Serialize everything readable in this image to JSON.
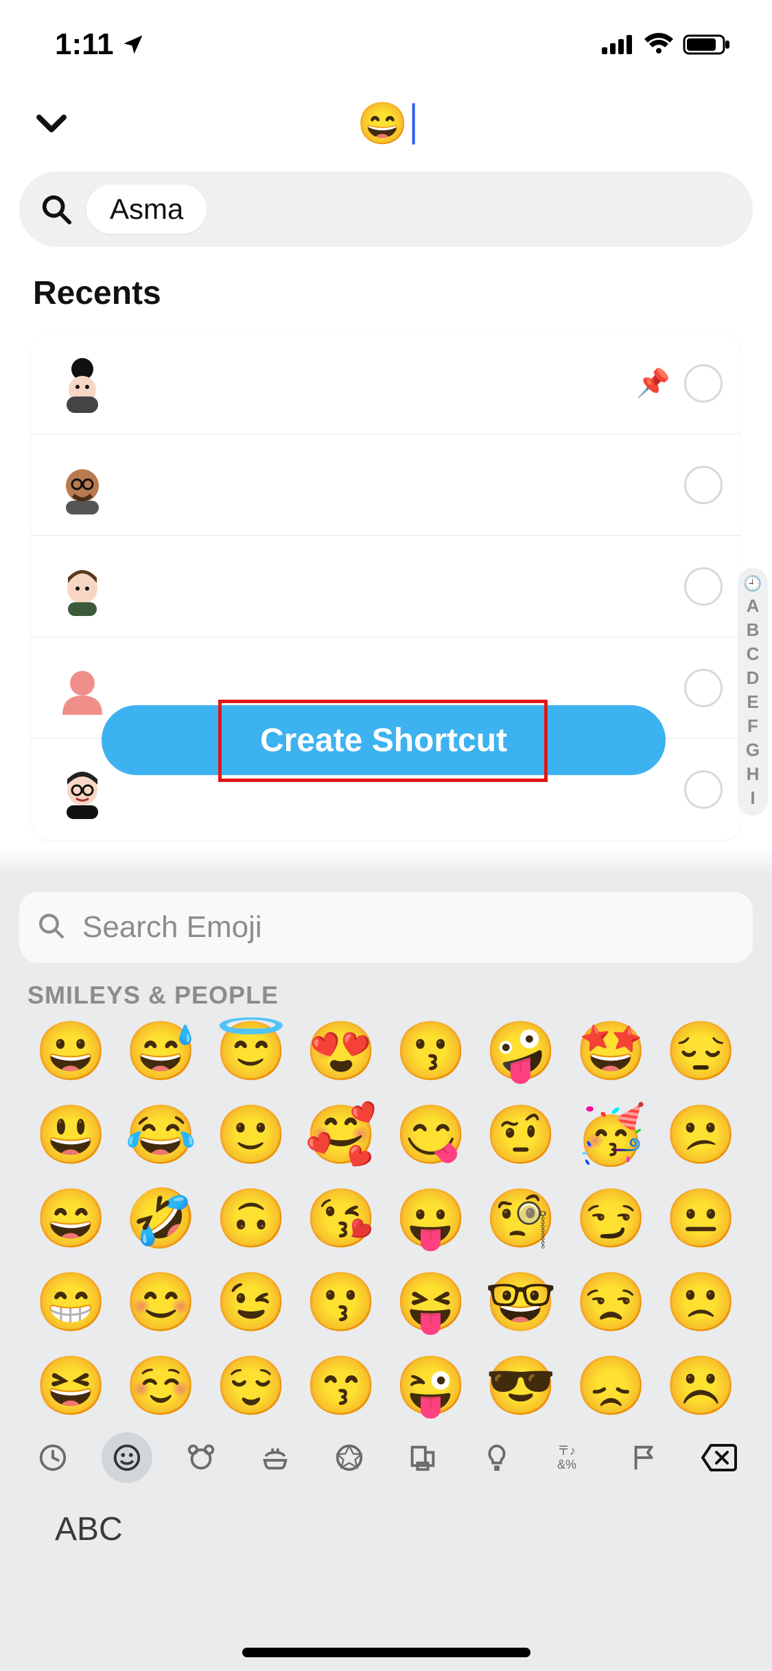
{
  "status": {
    "time": "1:11",
    "location_arrow": "➤"
  },
  "header": {
    "title_emoji": "😄"
  },
  "search": {
    "chip": "Asma"
  },
  "sections": {
    "recents_title": "Recents"
  },
  "contacts": [
    {
      "avatar": "person-bun",
      "pinned": true
    },
    {
      "avatar": "person-glasses-beard",
      "pinned": false
    },
    {
      "avatar": "person-boy",
      "pinned": false
    },
    {
      "avatar": "silhouette",
      "pinned": false
    },
    {
      "avatar": "person-glasses-smile",
      "pinned": false
    }
  ],
  "cta": {
    "label": "Create Shortcut"
  },
  "alpha_index": [
    "A",
    "B",
    "C",
    "D",
    "E",
    "F",
    "G",
    "H",
    "I"
  ],
  "keyboard": {
    "search_placeholder": "Search Emoji",
    "category_title": "SMILEYS & PEOPLE",
    "emoji_rows": [
      [
        "😀",
        "😅",
        "😇",
        "😍",
        "😗",
        "🤪",
        "🤩",
        "😔"
      ],
      [
        "😃",
        "😂",
        "🙂",
        "🥰",
        "😋",
        "🤨",
        "🥳",
        "😕"
      ],
      [
        "😄",
        "🤣",
        "🙃",
        "😘",
        "😛",
        "🧐",
        "😏",
        "😐"
      ],
      [
        "😁",
        "😊",
        "😉",
        "😗",
        "😝",
        "🤓",
        "😒",
        "🙁"
      ],
      [
        "😆",
        "☺️",
        "😌",
        "😙",
        "😜",
        "😎",
        "😞",
        "☹️"
      ]
    ],
    "tabs": [
      "🕘",
      "☻",
      "🐻",
      "🍔",
      "⚽",
      "🏙️",
      "💡",
      "🔣",
      "🏳️"
    ],
    "abc": "ABC"
  }
}
